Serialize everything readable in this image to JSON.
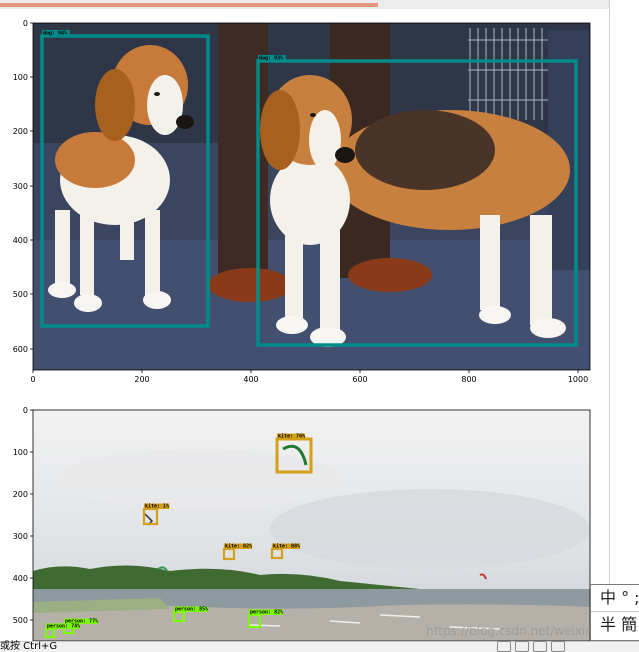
{
  "page": {
    "progress_percent": 78,
    "accent_color": "#e8987a"
  },
  "figures": [
    {
      "name": "beagle-detection",
      "x_ticks": [
        "0",
        "200",
        "400",
        "600",
        "800",
        "1000"
      ],
      "y_ticks": [
        "0",
        "100",
        "200",
        "300",
        "400",
        "500",
        "600"
      ],
      "box_color": "#008b8b",
      "detections": [
        {
          "label": "dog: 94%"
        },
        {
          "label": "dog: 93%"
        }
      ]
    },
    {
      "name": "kite-beach-detection",
      "y_ticks": [
        "0",
        "100",
        "200",
        "300",
        "400",
        "500"
      ],
      "kite_box_color": "#d4a017",
      "person_box_color": "#7cfc00",
      "detections": [
        {
          "label": "kite: 76%",
          "category": "kite"
        },
        {
          "label": "kite: 1%",
          "category": "kite"
        },
        {
          "label": "kite: 82%",
          "category": "kite"
        },
        {
          "label": "kite: 88%",
          "category": "kite"
        },
        {
          "label": "person: 85%",
          "category": "person"
        },
        {
          "label": "person: 82%",
          "category": "person"
        },
        {
          "label": "person: 77%",
          "category": "person"
        },
        {
          "label": "person: 74%",
          "category": "person"
        }
      ]
    }
  ],
  "status_bar": {
    "text": "或按 Ctrl+G",
    "icons": [
      "screen-icon",
      "help-icon",
      "keyboard-icon",
      "printer-icon"
    ]
  },
  "ime": {
    "row1": "中 ° ;",
    "row2": "半 簡"
  },
  "watermark": "https://blog.csdn.net/weixin_"
}
